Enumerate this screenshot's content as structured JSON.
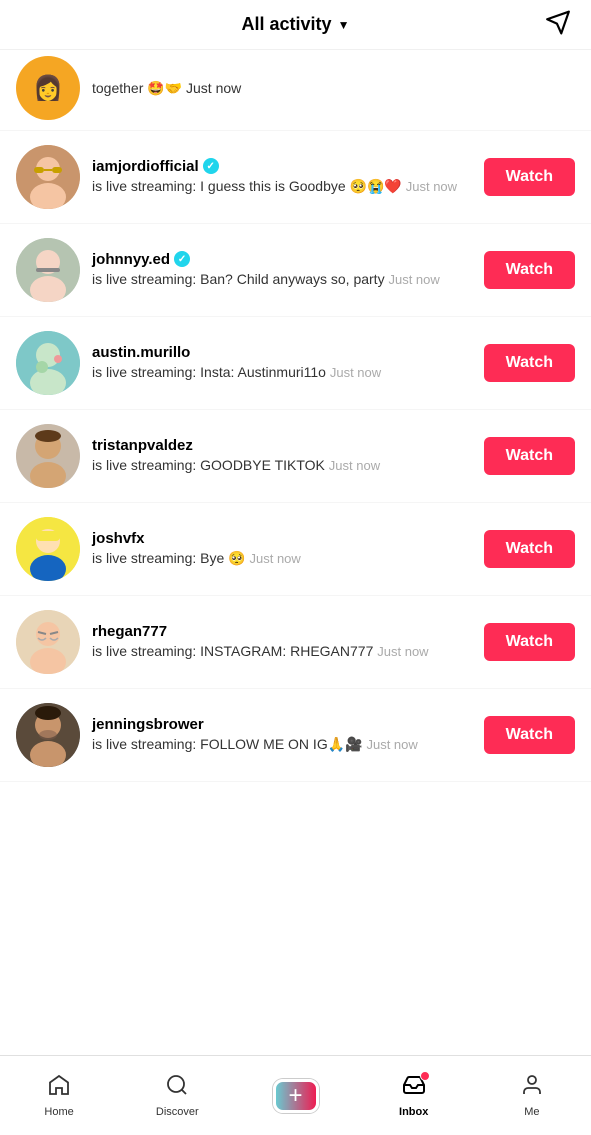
{
  "header": {
    "title": "All activity",
    "title_arrow": "▼",
    "send_label": "send-icon"
  },
  "partial_item": {
    "text": "together 🤩🤝 Just now"
  },
  "items": [
    {
      "username": "iamjordiofficial",
      "verified": true,
      "avatar_emoji": "👩",
      "avatar_color": "av-orange",
      "text": "is live streaming: I guess this is Goodbye 🥺😭❤️",
      "timestamp": "Just now",
      "watch_label": "Watch"
    },
    {
      "username": "johnnyy.ed",
      "verified": true,
      "avatar_emoji": "👦",
      "avatar_color": "av-green",
      "text": "is live streaming: Ban? Child anyways so, party",
      "timestamp": "Just now",
      "watch_label": "Watch"
    },
    {
      "username": "austin.murillo",
      "verified": false,
      "avatar_emoji": "🧑‍🎨",
      "avatar_color": "av-blue",
      "text": "is live streaming: Insta: Austinmuri11o",
      "timestamp": "Just now",
      "watch_label": "Watch"
    },
    {
      "username": "tristanpvaldez",
      "verified": false,
      "avatar_emoji": "👦",
      "avatar_color": "av-gray",
      "text": "is live streaming: GOODBYE TIKTOK",
      "timestamp": "Just now",
      "watch_label": "Watch"
    },
    {
      "username": "joshvfx",
      "verified": false,
      "avatar_emoji": "😎",
      "avatar_color": "av-yellow",
      "text": "is live streaming: Bye 🥺",
      "timestamp": "Just now",
      "watch_label": "Watch"
    },
    {
      "username": "rhegan777",
      "verified": false,
      "avatar_emoji": "🙄",
      "avatar_color": "av-tan",
      "text": "is live streaming: INSTAGRAM: RHEGAN777",
      "timestamp": "Just now",
      "watch_label": "Watch"
    },
    {
      "username": "jenningsbrower",
      "verified": false,
      "avatar_emoji": "👨",
      "avatar_color": "av-dark",
      "text": "is live streaming: FOLLOW ME ON IG🙏🎥",
      "timestamp": "Just now",
      "watch_label": "Watch"
    }
  ],
  "nav": {
    "items": [
      {
        "label": "Home",
        "icon": "🏠"
      },
      {
        "label": "Discover",
        "icon": "🔍"
      },
      {
        "label": "",
        "icon": "+"
      },
      {
        "label": "Inbox",
        "icon": "📥",
        "active": true
      },
      {
        "label": "Me",
        "icon": "👤"
      }
    ]
  }
}
